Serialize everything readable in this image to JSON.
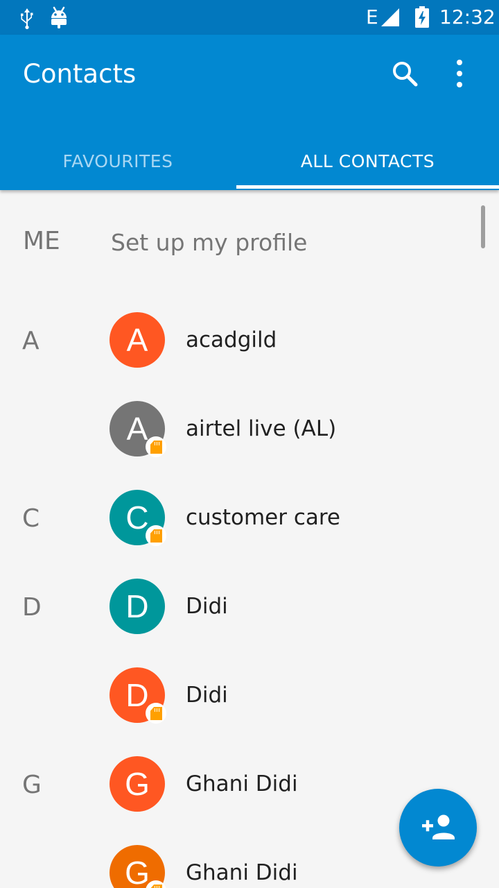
{
  "status_bar": {
    "network_type": "E",
    "time": "12:32",
    "icons": [
      "usb-icon",
      "android-debug-icon",
      "signal-icon",
      "battery-charging-icon"
    ]
  },
  "app_bar": {
    "title": "Contacts",
    "search_icon": "search-icon",
    "menu_icon": "more-vert-icon"
  },
  "tabs": [
    {
      "label": "FAVOURITES",
      "selected": false
    },
    {
      "label": "ALL CONTACTS",
      "selected": true
    }
  ],
  "me": {
    "label": "ME",
    "action": "Set up my profile"
  },
  "contacts": [
    {
      "section": "A",
      "initial": "A",
      "name": "acadgild",
      "color": "#ff5722",
      "sim": false
    },
    {
      "section": "",
      "initial": "A",
      "name": "airtel live (AL)",
      "color": "#757575",
      "sim": true
    },
    {
      "section": "C",
      "initial": "C",
      "name": "customer care",
      "color": "#00979b",
      "sim": true
    },
    {
      "section": "D",
      "initial": "D",
      "name": "Didi",
      "color": "#00979b",
      "sim": false
    },
    {
      "section": "",
      "initial": "D",
      "name": "Didi",
      "color": "#ff5722",
      "sim": true
    },
    {
      "section": "G",
      "initial": "G",
      "name": "Ghani Didi",
      "color": "#ff5722",
      "sim": false
    },
    {
      "section": "",
      "initial": "G",
      "name": "Ghani Didi",
      "color": "#ef6c00",
      "sim": true
    }
  ],
  "fab": {
    "icon": "add-person-icon"
  },
  "colors": {
    "primary": "#0288d1",
    "status_bar": "#0277bd",
    "background": "#f5f5f5"
  }
}
